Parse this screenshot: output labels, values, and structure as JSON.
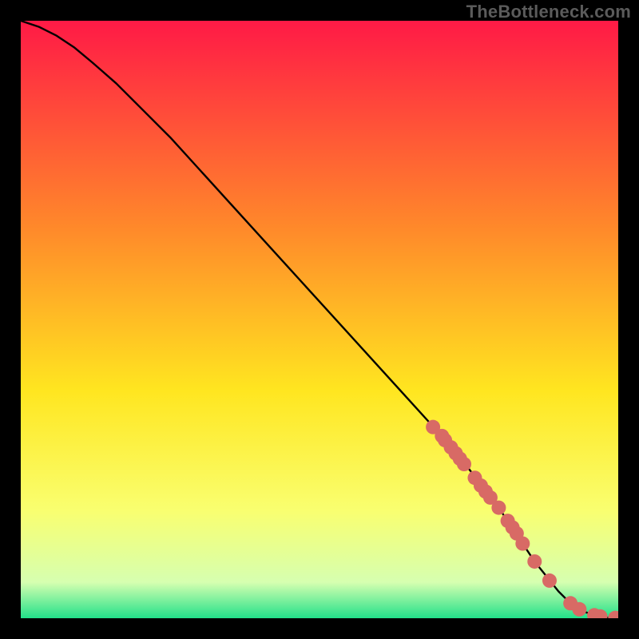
{
  "attribution": "TheBottleneck.com",
  "colors": {
    "bg_black": "#000000",
    "grad_top": "#ff1a46",
    "grad_mid1": "#ff8a2a",
    "grad_mid2": "#ffe620",
    "grad_mid3": "#f9ff70",
    "grad_mid4": "#d6ffb0",
    "grad_bottom": "#22e18a",
    "curve": "#000000",
    "marker": "#d86a65",
    "attribution_text": "#5b5b5b"
  },
  "chart_data": {
    "type": "line",
    "title": "",
    "xlabel": "",
    "ylabel": "",
    "xlim": [
      0,
      100
    ],
    "ylim": [
      0,
      100
    ],
    "grid": false,
    "legend": null,
    "annotations": [],
    "series": [
      {
        "name": "bottleneck-curve",
        "x": [
          0,
          3,
          6,
          9,
          12,
          16,
          20,
          25,
          30,
          35,
          40,
          45,
          50,
          55,
          60,
          65,
          70,
          75,
          80,
          84,
          86,
          88,
          90,
          92,
          94,
          96,
          98,
          100
        ],
        "y": [
          100,
          99,
          97.5,
          95.5,
          93,
          89.5,
          85.5,
          80.5,
          75,
          69.5,
          64,
          58.5,
          53,
          47.5,
          42,
          36.5,
          31,
          25,
          18.5,
          12.5,
          9.5,
          7,
          4.5,
          2.5,
          1.2,
          0.5,
          0.1,
          0
        ]
      }
    ],
    "markers": {
      "name": "highlighted-points",
      "x": [
        69,
        70.5,
        71,
        72,
        72.8,
        73.5,
        74.2,
        76,
        77,
        77.8,
        78.6,
        80,
        81.5,
        82.3,
        83,
        84,
        86,
        88.5,
        92,
        93.5,
        96,
        97,
        99.5,
        100
      ],
      "y": [
        32,
        30.5,
        29.8,
        28.6,
        27.6,
        26.7,
        25.8,
        23.5,
        22.2,
        21.2,
        20.2,
        18.5,
        16.3,
        15.2,
        14.2,
        12.5,
        9.5,
        6.3,
        2.5,
        1.5,
        0.5,
        0.3,
        0.05,
        0
      ]
    }
  }
}
